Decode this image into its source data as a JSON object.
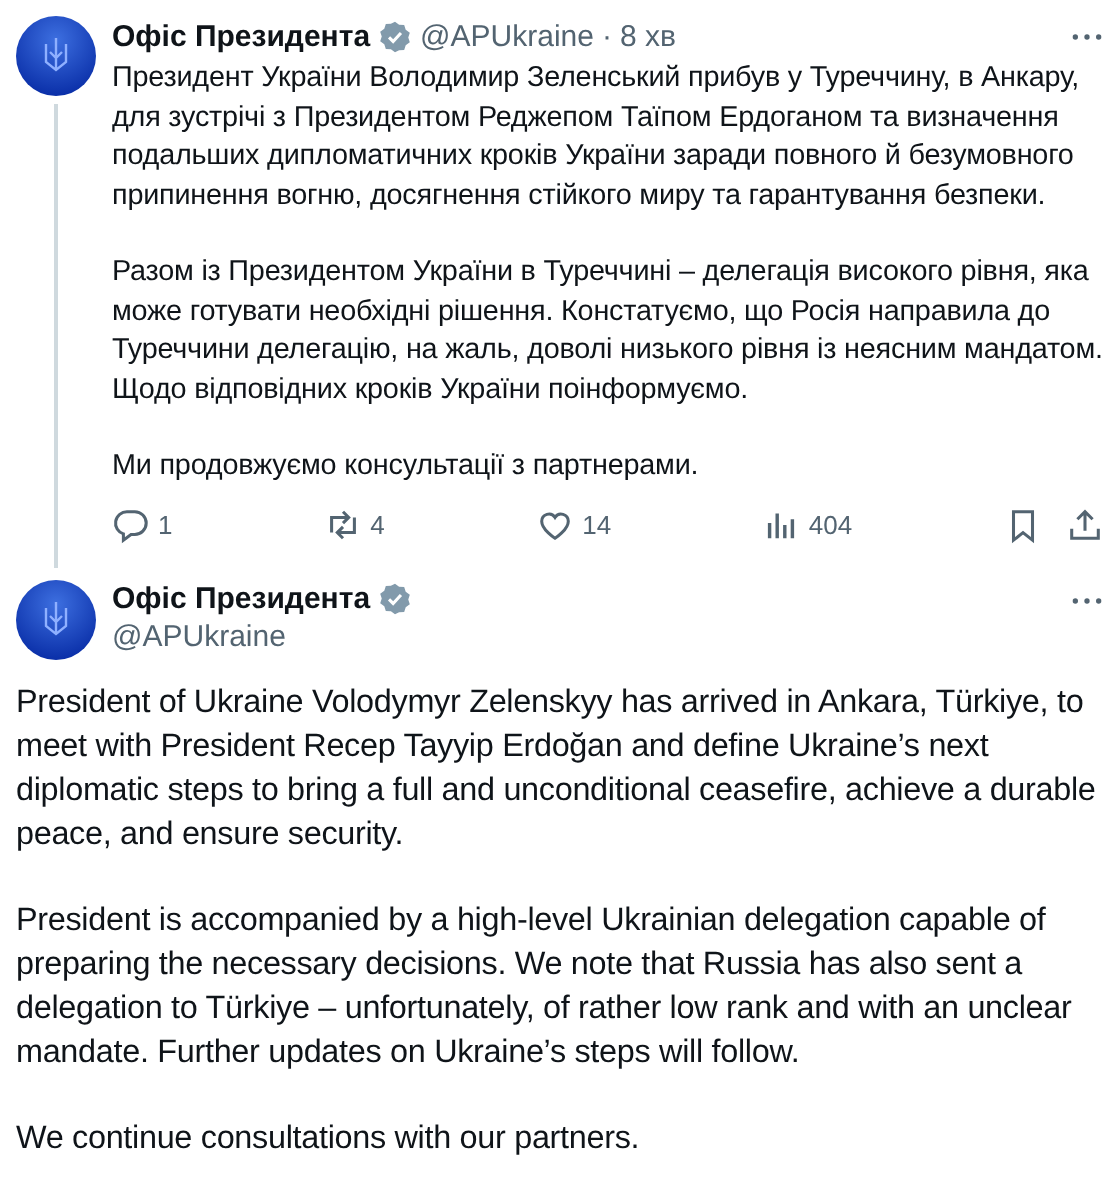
{
  "posts": [
    {
      "kind": "thread",
      "author": "Офіс Президента",
      "verified": true,
      "handle": "@APUkraine",
      "separator": "·",
      "time": "8 хв",
      "paragraphs": [
        "Президент України Володимир Зеленський прибув у Туреччину, в Анкару, для зустрічі з Президентом Реджепом Таїпом Ердоганом та визначення подальших дипломатичних кроків України заради повного й безумовного припинення вогню, досягнення стійкого миру та гарантування безпеки.",
        "Разом із Президентом України в Туреччині – делегація високого рівня, яка може готувати необхідні рішення. Констатуємо, що Росія направила до Туреччини делегацію, на жаль, доволі низького рівня із неясним мандатом. Щодо відповідних кроків України поінформуємо.",
        "Ми продовжуємо консультації з партнерами."
      ],
      "actions": [
        {
          "kind": "reply",
          "count": "1"
        },
        {
          "kind": "repost",
          "count": "4"
        },
        {
          "kind": "like",
          "count": "14"
        },
        {
          "kind": "views",
          "count": "404"
        },
        {
          "kind": "bookmark"
        },
        {
          "kind": "share"
        }
      ]
    },
    {
      "kind": "main",
      "author": "Офіс Президента",
      "verified": true,
      "handle": "@APUkraine",
      "paragraphs": [
        "President of Ukraine Volodymyr Zelenskyy has arrived in Ankara, Türkiye, to meet with President Recep Tayyip Erdoğan and define Ukraine’s next diplomatic steps to bring a full and unconditional ceasefire, achieve a durable peace, and ensure security.",
        "President is accompanied by a high-level Ukrainian delegation capable of preparing the necessary decisions. We note that Russia has also sent a delegation to Türkiye – unfortunately, of rather low rank and with an unclear mandate. Further updates on Ukraine’s steps will follow.",
        "We continue consultations with our partners."
      ]
    }
  ]
}
